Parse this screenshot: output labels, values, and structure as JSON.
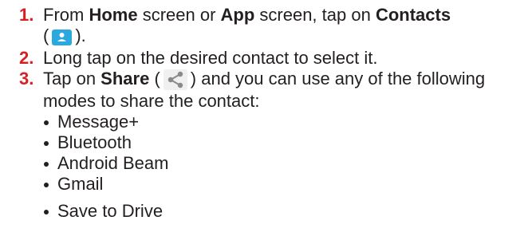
{
  "steps": [
    {
      "number": "1.",
      "t1": "From ",
      "b1": "Home",
      "t2": " screen or ",
      "b2": "App",
      "t3": " screen, tap on ",
      "b3": "Contacts",
      "t4": "(",
      "t5": ")."
    },
    {
      "number": "2.",
      "text": "Long tap on the desired contact to select it."
    },
    {
      "number": "3.",
      "t1": "Tap on ",
      "b1": "Share",
      "t2": " (",
      "t3": ") and you can use any of the following modes to share the contact:"
    }
  ],
  "share_modes": [
    "Message+",
    "Bluetooth",
    "Android Beam",
    "Gmail",
    "Save to Drive"
  ],
  "colors": {
    "step_number": "#d72024",
    "contacts_icon": "#2aa9e0",
    "text": "#231f20"
  },
  "icons": {
    "contacts": "contacts-icon",
    "share": "share-icon"
  }
}
